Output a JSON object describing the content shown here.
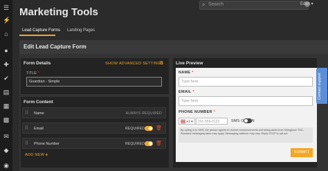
{
  "app": {
    "page_title": "Marketing Tools",
    "search_placeholder": "Search",
    "user_name": "Eden"
  },
  "tabs": [
    {
      "label": "Lead Capture Forms",
      "active": true
    },
    {
      "label": "Landing Pages",
      "active": false
    }
  ],
  "edit": {
    "title": "Edit Lead Capture Form"
  },
  "form_details": {
    "heading": "Form Details",
    "advanced_label": "SHOW ADVANCED SETTINGS",
    "title_label": "TITLE",
    "title_value": "Guardian - Simple"
  },
  "form_content": {
    "heading": "Form Content",
    "rows": [
      {
        "label": "Name",
        "status": "ALWAYS REQUIRED"
      },
      {
        "label": "Email",
        "status": "REQUIRED"
      },
      {
        "label": "Phone Number",
        "status": "REQUIRED"
      }
    ],
    "add_new_label": "ADD NEW"
  },
  "preview": {
    "heading": "Live Preview",
    "name_label": "NAME",
    "name_placeholder": "Type here",
    "email_label": "EMAIL",
    "email_placeholder": "Type here",
    "phone_label": "PHONE NUMBER",
    "phone_code": "+1",
    "phone_placeholder": "201-555-0123",
    "sms_label": "SMS OPT-IN",
    "disclaimer": "By opting in to SMS, the person agrees to receive announcements and billing alerts from Vikingtown TKD. Standard messaging rates may apply. Messaging cadence may vary. Reply STOP to opt out.",
    "submit_label": "SUBMIT"
  },
  "support": {
    "label": "Contact support"
  },
  "colors": {
    "accent": "#f5a623",
    "danger": "#e74c3c",
    "support": "#5b8fd9"
  }
}
